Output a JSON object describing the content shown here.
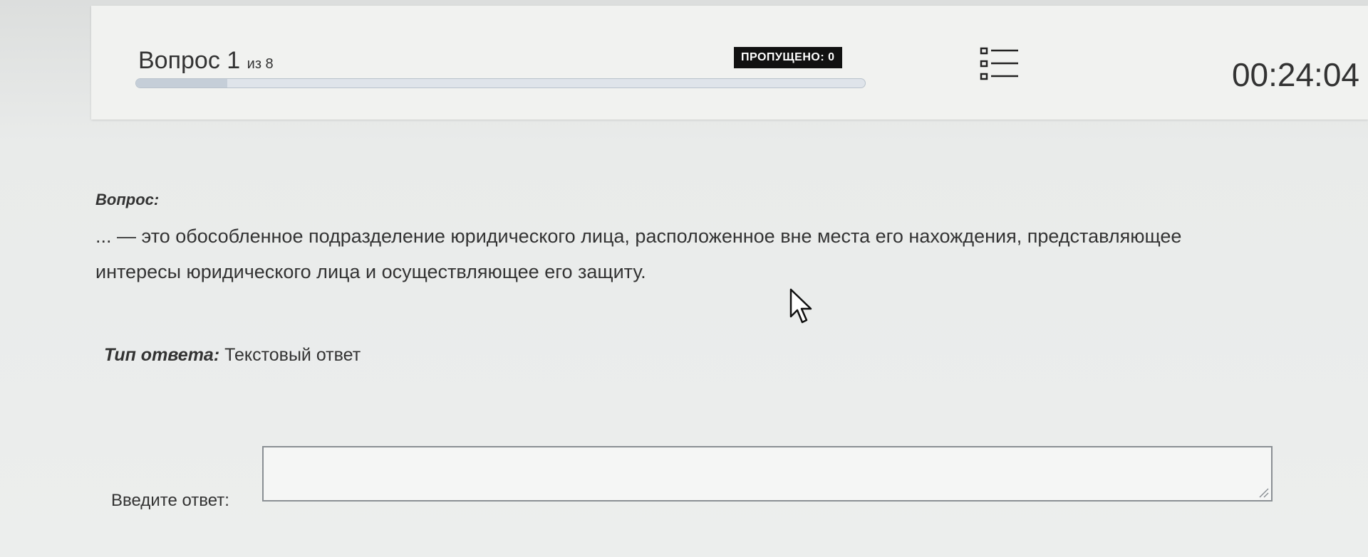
{
  "header": {
    "question_label": "Вопрос",
    "question_number": "1",
    "of_label": "из 8",
    "progress_fraction": 0.125,
    "skipped_label": "ПРОПУЩЕНО: 0",
    "timer": "00:24:04",
    "list_icon": "list-icon"
  },
  "question": {
    "label": "Вопрос:",
    "text": "... — это обособленное подразделение юридического лица, расположенное вне места его нахождения, представляющее интересы юридического лица и осуществляющее его защиту."
  },
  "answer": {
    "type_label": "Тип ответа:",
    "type_value": "Текстовый ответ",
    "input_label": "Введите ответ:",
    "input_value": ""
  },
  "colors": {
    "badge_bg": "#111111",
    "badge_text": "#ffffff",
    "progress_track": "#dfe4ea",
    "page_bg": "#e6e8e7"
  }
}
